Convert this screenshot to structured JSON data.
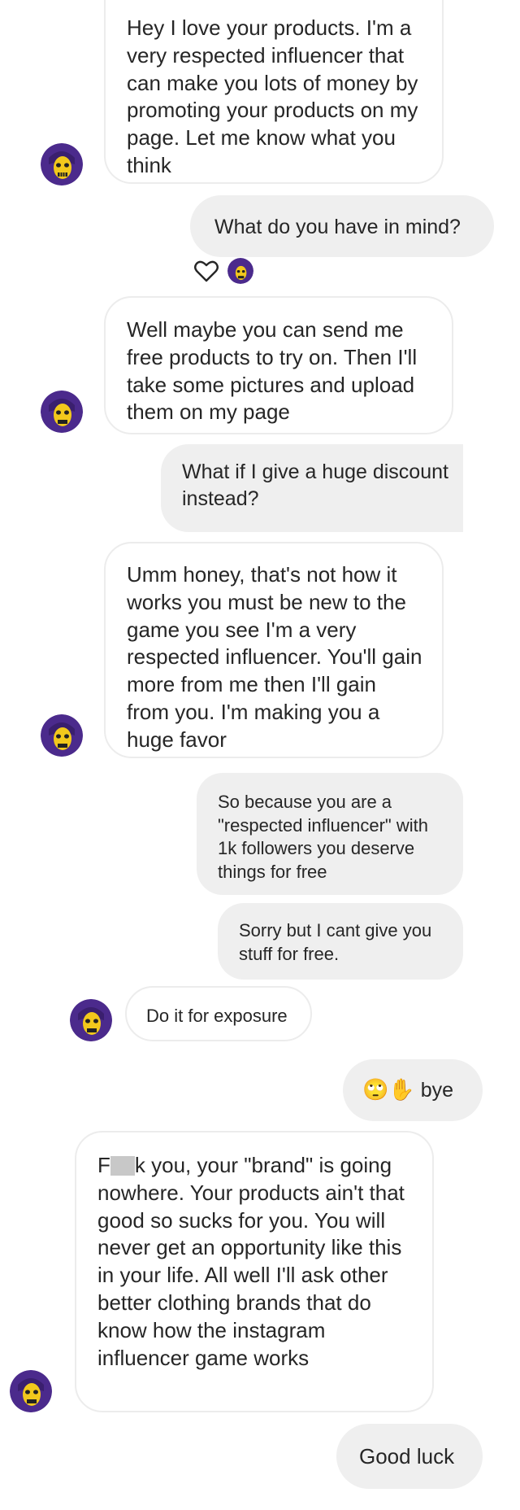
{
  "thread": {
    "messages": [
      {
        "sender": "influencer",
        "text": "Hey I love your products. I'm a very respected influencer that can make you lots of money by promoting your products on my page. Let me know what you think"
      },
      {
        "sender": "brand",
        "text": "What do you have in mind?"
      },
      {
        "sender": "influencer",
        "text": "Well maybe you can send me free products to try on. Then I'll take some pictures and upload them on my page"
      },
      {
        "sender": "brand",
        "text": "What if I give a huge discount instead?"
      },
      {
        "sender": "influencer",
        "text": "Umm honey, that's not how it works you must be new to the game you see I'm a very respected influencer. You'll gain more from me then I'll gain from you. I'm making you a huge favor"
      },
      {
        "sender": "brand",
        "text": "So because you are a \"respected influencer\" with 1k followers you deserve things for free"
      },
      {
        "sender": "brand",
        "text": "Sorry but I cant give you stuff for free."
      },
      {
        "sender": "influencer",
        "text": "Do it for exposure"
      },
      {
        "sender": "brand",
        "emoji": "🙄✋",
        "text": "bye"
      },
      {
        "sender": "influencer",
        "text_before": "F",
        "text_after": "k you, your \"brand\" is going nowhere. Your products ain't that good so sucks for you. You will never get an opportunity like this in your life. All well I'll ask other better clothing brands that do know how the instagram influencer game works"
      },
      {
        "sender": "brand",
        "text": "Good luck"
      }
    ]
  },
  "colors": {
    "bubble_incoming_bg": "#ffffff",
    "bubble_incoming_border": "#ececec",
    "bubble_outgoing_bg": "#efefef",
    "text": "#262626",
    "avatar_bg": "#4b2a8c",
    "skull": "#f2c81c"
  },
  "icons": {
    "heart": "heart-outline-icon",
    "avatar": "skeletor-avatar"
  }
}
